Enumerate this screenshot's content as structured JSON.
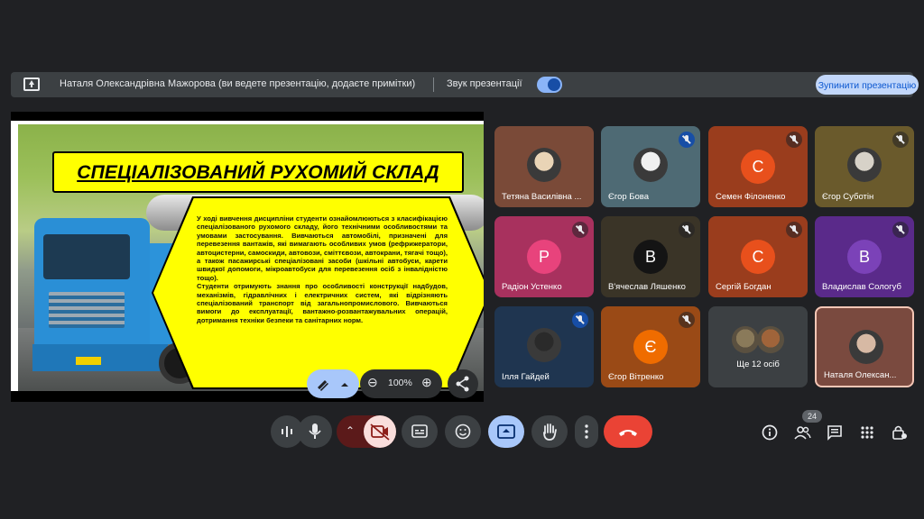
{
  "banner": {
    "text": "Наталя Олександрівна Мажорова (ви ведете презентацію, додаєте примітки)",
    "sound_label": "Звук презентації",
    "stop_label": "Зупинити презентацію",
    "sound_on": true
  },
  "slide": {
    "title": "СПЕЦІАЛІЗОВАНИЙ РУХОМИЙ СКЛАД",
    "paragraph1": "У ході вивчення дисципліни студенти ознайомлюються з класифікацією спеціалізованого рухомого складу, його технічними особливостями та умовами застосування. Вивчаються автомобілі, призначені для перевезення вантажів, які вимагають особливих умов (рефрижератори, автоцистерни, самоскиди, автовози, сміттєвози, автокрани, тягачі тощо), а також пасажирські спеціалізовані засоби (шкільні автобуси, карети швидкої допомоги, мікроавтобуси для перевезення осіб з інвалідністю тощо).",
    "paragraph2": "Студенти отримують знання про особливості конструкції надбудов, механізмів, гідравлічних і електричних систем, які відрізняють спеціалізований транспорт від загальнопромислового. Вивчаються вимоги до експлуатації, вантажно-розвантажувальних операцій, дотримання техніки безпеки та санітарних норм."
  },
  "slide_controls": {
    "zoom_level": "100%"
  },
  "participants": [
    {
      "name": "Тетяна Василівна ...",
      "type": "photo",
      "bg": "#7a4a38",
      "muted": false,
      "photo_color": "#e9d4b6"
    },
    {
      "name": "Єгор Бова",
      "type": "photo",
      "bg": "#4e6a74",
      "muted": true,
      "mute_style": "blue",
      "photo_color": "#f0f0f0"
    },
    {
      "name": "Семен Філоненко",
      "type": "letter",
      "letter": "С",
      "bg": "#9a3d1d",
      "avatar_color": "#e8501c",
      "muted": true
    },
    {
      "name": "Єгор Суботін",
      "type": "photo",
      "bg": "#6a5a2c",
      "muted": true,
      "photo_color": "#d7d2c8"
    },
    {
      "name": "Радіон Устенко",
      "type": "letter",
      "letter": "Р",
      "bg": "#a8315e",
      "avatar_color": "#e8437c",
      "muted": true
    },
    {
      "name": "В'ячеслав Ляшенко",
      "type": "letter",
      "letter": "В",
      "bg": "#3a3427",
      "avatar_color": "#141414",
      "muted": true
    },
    {
      "name": "Сергій Богдан",
      "type": "letter",
      "letter": "С",
      "bg": "#9a3d1d",
      "avatar_color": "#e8501c",
      "muted": true
    },
    {
      "name": "Владислав Сологуб",
      "type": "letter",
      "letter": "В",
      "bg": "#5a2a8a",
      "avatar_color": "#7b42b8",
      "muted": true
    },
    {
      "name": "Ілля Гайдей",
      "type": "photo",
      "bg": "#1f3550",
      "muted": true,
      "mute_style": "blue",
      "photo_color": "#2a2a2a"
    },
    {
      "name": "Єгор Вітренко",
      "type": "letter",
      "letter": "Є",
      "bg": "#9a4a16",
      "avatar_color": "#ef6c00",
      "muted": true
    },
    {
      "name": "Ще 12 осіб",
      "type": "group",
      "bg": "#3c4043",
      "muted": false
    },
    {
      "name": "Наталя Олексан...",
      "type": "photo",
      "bg": "#7a4a3f",
      "muted": false,
      "photo_color": "#d7b9a4",
      "highlight": true
    }
  ],
  "toolbar": {
    "people_count": "24"
  }
}
